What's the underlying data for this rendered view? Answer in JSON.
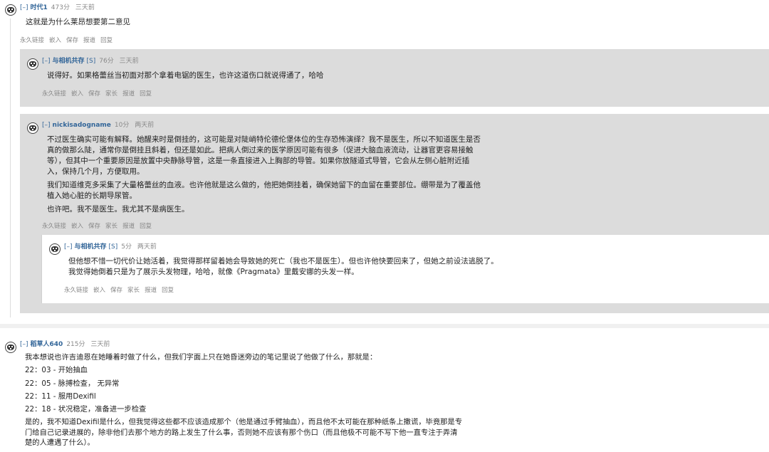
{
  "expand_glyph": "[–]",
  "comments": [
    {
      "author": "时代1",
      "flair": "",
      "score": "473分",
      "time": "三天前",
      "paragraphs": [
        "这就是为什么莱昂想要第二意见"
      ],
      "buttons": [
        "永久链接",
        "嵌入",
        "保存",
        "报道",
        "回复"
      ]
    },
    {
      "author": "与相机共存",
      "flair": "[S]",
      "score": "76分",
      "time": "三天前",
      "paragraphs": [
        "说得好。如果格蕾丝当初面对那个拿着电锯的医生，也许这道伤口就说得通了，哈哈"
      ],
      "buttons": [
        "永久链接",
        "嵌入",
        "保存",
        "家长",
        "报道",
        "回复"
      ]
    },
    {
      "author": "nickisadogname",
      "flair": "",
      "score": "10分",
      "time": "两天前",
      "paragraphs": [
        "不过医生确实可能有解释。她醒来时是倒挂的，这可能是对陡峭特伦德伦堡体位的生存恐怖演绎？我不是医生，所以不知道医生是否真的做那么陡，通常你是倒挂且斜着，但还是如此。把病人倒过来的医学原因可能有很多（促进大脑血液流动，让器官更容易接触等），但其中一个重要原因是放置中央静脉导管，这是一条直接进入上胸部的导管。如果你放隧道式导管，它会从左侧心脏附近插入，保持几个月，方便取用。",
        "我们知道维克多采集了大量格蕾丝的血液。也许他就是这么做的，他把她倒挂着，确保她留下的血留在重要部位。绷带是为了覆盖他植入她心脏的长期导尿管。",
        "也许吧。我不是医生。我尤其不是病医生。"
      ],
      "buttons": [
        "永久链接",
        "嵌入",
        "保存",
        "家长",
        "报道",
        "回复"
      ]
    },
    {
      "author": "与相机共存",
      "flair": "[S]",
      "score": "5分",
      "time": "两天前",
      "paragraphs": [
        "但他想不惜一切代价让她活着，我觉得那样留着她会导致她的死亡（我也不是医生）。但也许他快要回来了，但她之前设法逃脱了。 我觉得她倒着只是为了展示头发物理，哈哈，就像《Pragmata》里戴安娜的头发一样。"
      ],
      "buttons": [
        "永久链接",
        "嵌入",
        "保存",
        "家长",
        "报道",
        "回复"
      ]
    },
    {
      "author": "稻草人640",
      "flair": "",
      "score": "215分",
      "time": "三天前",
      "paragraphs": [
        "我本想说也许吉迪恩在她睡着时做了什么，但我们字面上只在她昏迷旁边的笔记里说了他做了什么，那就是：",
        "22：03 - 开始抽血",
        "22：05 - 脉搏检查，  无异常",
        "22：11 - 服用Dexifil",
        "22：18 - 状况稳定，准备进一步检查",
        "是的，我不知道Dexifil是什么，但我觉得这些都不应该造成那个（他是通过手臂抽血），而且他不太可能在那种纸条上撒谎，毕竟那是专门给自己记录进展的，除非他们去那个地方的路上发生了什么事，否则她不应该有那个伤口（而且他极不可能不写下他一直专注于弄清楚的人遭遇了什么）。"
      ],
      "buttons": []
    }
  ]
}
